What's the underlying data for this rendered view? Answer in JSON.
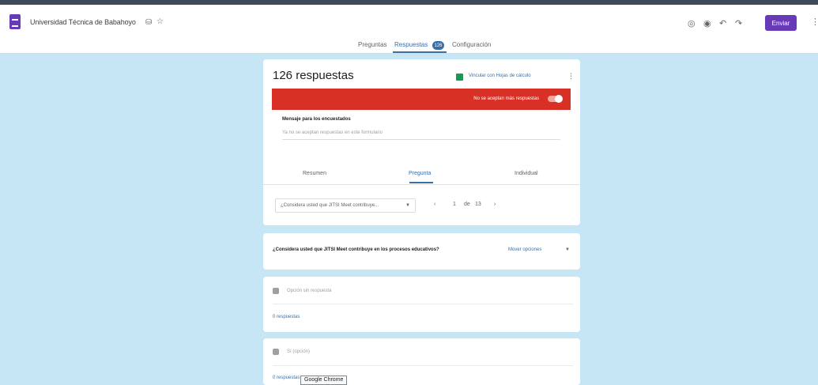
{
  "header": {
    "doc_title": "Universidad Técnica de Babahoyo",
    "send_label": "Enviar"
  },
  "tabs": [
    {
      "label": "Preguntas"
    },
    {
      "label": "Respuestas"
    },
    {
      "label": "Configuración"
    }
  ],
  "tab_badge": "126",
  "summary": {
    "count_label": "126 respuestas",
    "sheets_link": "Vincular con Hojas de cálculo",
    "banner_text": "No se aceptan más respuestas",
    "message_label": "Mensaje para los encuestados",
    "message_placeholder": "Ya no se aceptan respuestas en este formulario",
    "subtabs": [
      "Resumen",
      "Pregunta",
      "Individual"
    ]
  },
  "question_nav": {
    "selected_question": "¿Considera usted que JITSI Meet contribuye...",
    "page_current": "1",
    "page_of": "de",
    "page_total": "13"
  },
  "question_card": {
    "question_text": "¿Considera usted que JITSI Meet contribuye en los procesos educativos?",
    "dropdown_label": "Mover opciones"
  },
  "option_card": {
    "option_label": "Opción sin respuesta",
    "responses_label": "0 respuestas"
  },
  "option_card2": {
    "option_label": "Sí (opción)",
    "responses_label": "0 respuestas"
  },
  "tooltip": "Google Chrome",
  "colors": {
    "brand": "#673ab7",
    "banner": "#d93025",
    "link": "#3a6ea5",
    "background": "#c6e5f5"
  }
}
